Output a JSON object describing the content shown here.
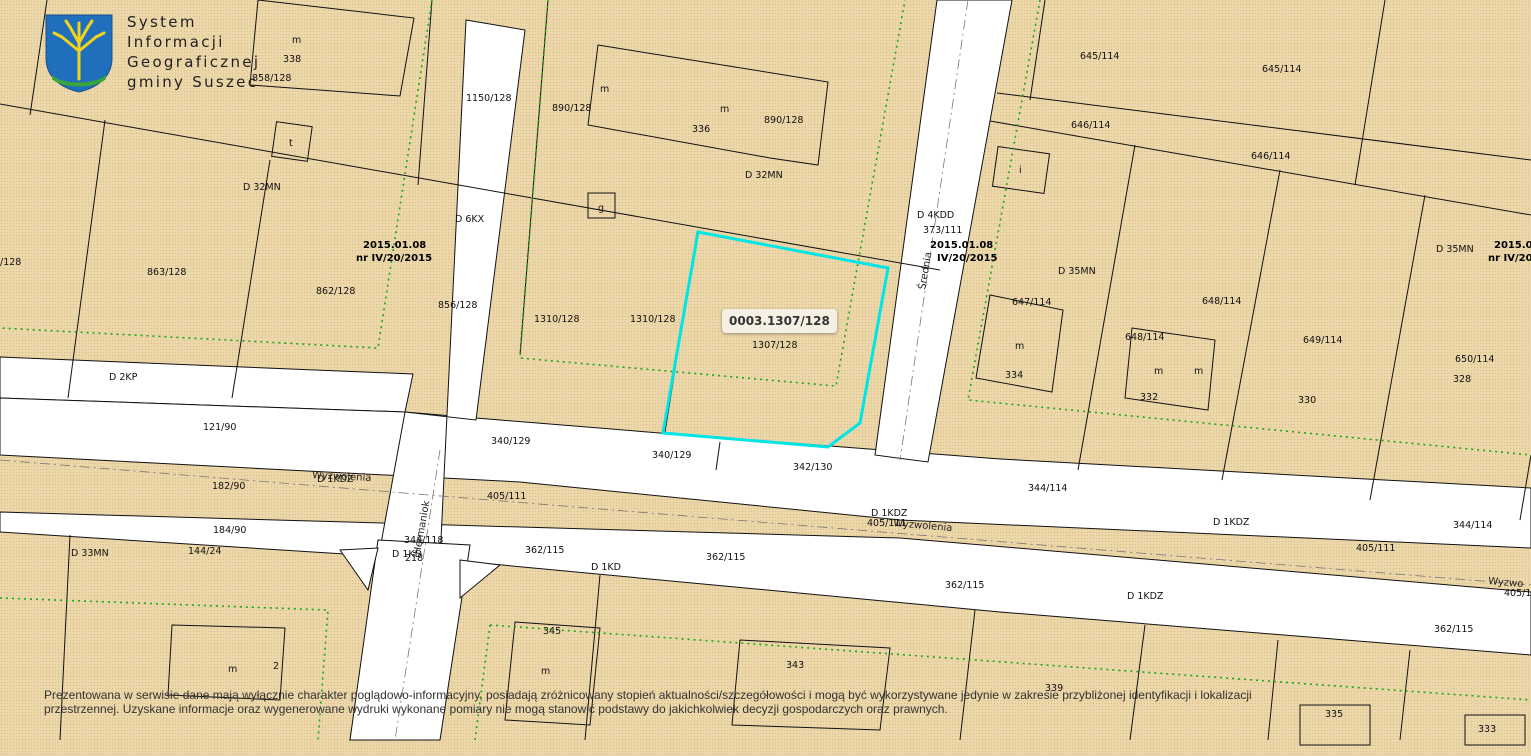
{
  "brand": {
    "lines": [
      "System",
      "Informacji",
      "Geograficznej",
      "gminy Suszec"
    ]
  },
  "selected_parcel": {
    "label": "0003.1307/128",
    "highlight_color": "#00e5e5"
  },
  "disclaimer": "Prezentowana w serwisie dane mają wyłącznie charakter poglądowo-informacyjny, posiadają zróżnicowany stopień aktualności/szczegółowości i mogą być wykorzystywane jedynie w zakresie przybliżonej identyfikacji i lokalizacji przestrzennej. Uzyskane informacje oraz wygenerowane wydruki wykonane pomiary nie mogą stanowić podstawy do jakichkolwiek decyzji gospodarczych oraz prawnych.",
  "colors": {
    "parcel_fill": "#e9d3a2",
    "road_fill": "#ffffff",
    "zone_boundary": "#1aa81a",
    "parcel_line": "#111111"
  },
  "parcel_labels": [
    "338",
    "858/128",
    "m",
    "1150/128",
    "890/128",
    "m",
    "m",
    "336",
    "890/128",
    "645/114",
    "645/114",
    "646/114",
    "646/114",
    "t",
    "g",
    "i",
    "D 32MN",
    "D 32MN",
    "D 6KX",
    "D 4KDD",
    "373/111",
    "D 35MN",
    "D 35MN",
    "863/128",
    "862/128",
    "/128",
    "856/128",
    "1310/128",
    "1310/128",
    "1307/128",
    "647/114",
    "648/114",
    "648/114",
    "649/114",
    "650/114",
    "m",
    "334",
    "m",
    "m",
    "332",
    "330",
    "328",
    "D 2KP",
    "121/90",
    "340/129",
    "340/129",
    "342/130",
    "344/114",
    "182/90",
    "D 1KDZ",
    "405/111",
    "D 1KDZ",
    "405/111",
    "D 1KDZ",
    "344/114",
    "405/111",
    "184/90",
    "D 33MN",
    "144/24",
    "344/118",
    "D 1KD",
    "218",
    "362/115",
    "362/115",
    "D 1KD",
    "362/115",
    "D 1KDZ",
    "405/11",
    "362/115",
    "345",
    "343",
    "339",
    "m",
    "m",
    "2",
    "335",
    "333"
  ],
  "plan_labels": [
    {
      "date": "2015.01.08",
      "number": "nr IV/20/2015"
    },
    {
      "date": "2015.01.08",
      "number": "IV/20/2015"
    },
    {
      "date": "2015.01",
      "number": "nr IV/20/2"
    }
  ],
  "street_names": [
    "Wyzwolenia",
    "Wyzwolenia",
    "Wyzwo",
    "Średnia",
    "Hermaniok"
  ]
}
